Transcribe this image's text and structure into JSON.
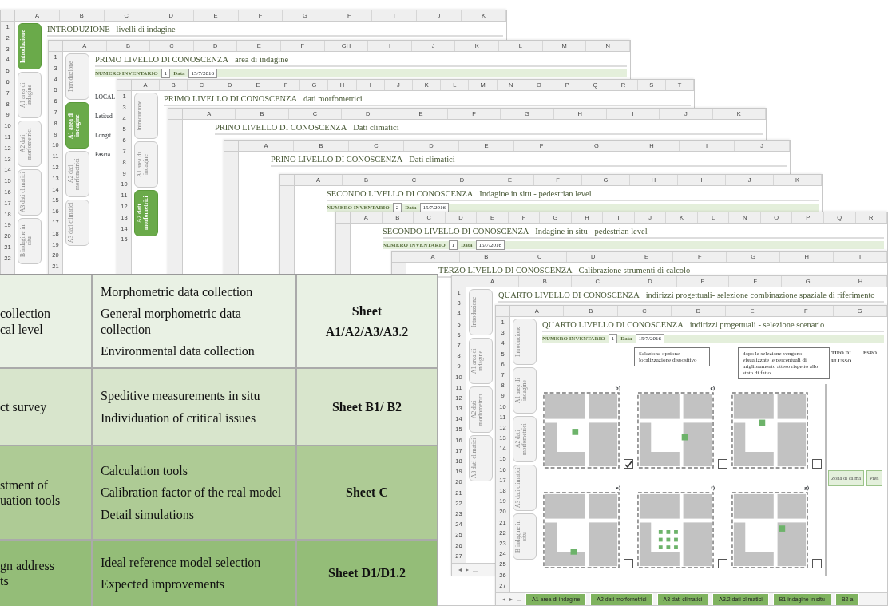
{
  "sheets": [
    {
      "title": "INTRODUZIONE",
      "subtitle": "livelli di indagine",
      "columns": [
        "A",
        "B",
        "C",
        "D",
        "E",
        "F",
        "G",
        "H",
        "I",
        "J",
        "K"
      ],
      "rows": [
        "1",
        "2",
        "3",
        "4",
        "5",
        "6",
        "7",
        "8",
        "9",
        "10",
        "11",
        "12",
        "13",
        "14",
        "15",
        "16",
        "17",
        "18",
        "19",
        "20",
        "21",
        "22"
      ],
      "side_tabs": [
        {
          "label": "Introduzione",
          "selected": true
        },
        {
          "label": "A1 area di indagine",
          "selected": false
        },
        {
          "label": "A2 dati morfometrici",
          "selected": false
        },
        {
          "label": "A3 dati climatici",
          "selected": false
        },
        {
          "label": "B indagine in situ",
          "selected": false
        }
      ]
    },
    {
      "title": "PRIMO LIVELLO DI CONOSCENZA",
      "subtitle": "area di indagine",
      "columns": [
        "A",
        "B",
        "C",
        "D",
        "E",
        "F",
        "GH",
        "I",
        "J",
        "K",
        "L",
        "M",
        "N"
      ],
      "rows": [
        "1",
        "3",
        "4",
        "5",
        "6",
        "7",
        "8",
        "9",
        "10",
        "11",
        "12",
        "13",
        "14",
        "15",
        "16",
        "17",
        "18",
        "19",
        "20",
        "21"
      ],
      "side_tabs": [
        {
          "label": "Introduzione",
          "selected": false
        },
        {
          "label": "A1 area di indagine",
          "selected": true
        },
        {
          "label": "A2 dati morfometrici",
          "selected": false
        },
        {
          "label": "A3 dati climatici",
          "selected": false
        }
      ],
      "inventory": {
        "label": "NUMERO INVENTARIO",
        "number": "1",
        "date_label": "Data",
        "date": "15/7/2016"
      },
      "body_labels": [
        "LOCAL",
        "Latitud",
        "Longit",
        "Fascia"
      ]
    },
    {
      "title": "PRIMO LIVELLO DI CONOSCENZA",
      "subtitle": "dati morfometrici",
      "columns": [
        "A",
        "B",
        "C",
        "D",
        "E",
        "F",
        "G",
        "H",
        "I",
        "J",
        "K",
        "L",
        "M",
        "N",
        "O",
        "P",
        "Q",
        "R",
        "S",
        "T"
      ],
      "rows": [
        "1",
        "3",
        "4",
        "5",
        "6",
        "7",
        "8",
        "9",
        "10",
        "11",
        "12",
        "13",
        "14",
        "15"
      ],
      "side_tabs": [
        {
          "label": "Introduzione",
          "selected": false
        },
        {
          "label": "A1 area di indagine",
          "selected": false
        },
        {
          "label": "A2 dati morfometrici",
          "selected": true
        }
      ]
    },
    {
      "title": "PRINO LIVELLO DI CONOSCENZA",
      "subtitle": "Dati climatici",
      "columns": [
        "A",
        "B",
        "C",
        "D",
        "E",
        "F",
        "G",
        "H",
        "I",
        "J",
        "K"
      ]
    },
    {
      "title": "PRINO LIVELLO DI CONOSCENZA",
      "subtitle": "Dati climatici",
      "columns": [
        "A",
        "B",
        "C",
        "D",
        "E",
        "F",
        "G",
        "H",
        "I",
        "J"
      ]
    },
    {
      "title": "SECONDO LIVELLO DI CONOSCENZA",
      "subtitle": "Indagine in situ - pedestrian level",
      "columns": [
        "A",
        "B",
        "C",
        "D",
        "E",
        "F",
        "G",
        "H",
        "I",
        "J",
        "K"
      ],
      "inventory": {
        "label": "NUMERO INVENTARIO",
        "number": "2",
        "date_label": "Data",
        "date": "15/7/2016"
      }
    },
    {
      "title": "SECONDO LIVELLO DI CONOSCENZA",
      "subtitle": "Indagine in situ - pedestrian level",
      "columns": [
        "A",
        "B",
        "C",
        "D",
        "E",
        "F",
        "G",
        "H",
        "I",
        "J",
        "K",
        "L",
        "N",
        "O",
        "P",
        "Q",
        "R"
      ],
      "inventory": {
        "label": "NUMERO INVENTARIO",
        "number": "1",
        "date_label": "Data",
        "date": "15/7/2016"
      }
    },
    {
      "title": "TERZO LIVELLO DI CONOSCENZA",
      "subtitle": "Calibrazione strumenti di calcolo",
      "columns": [
        "A",
        "B",
        "C",
        "D",
        "E",
        "F",
        "G",
        "H",
        "I"
      ]
    },
    {
      "title": "QUARTO LIVELLO DI CONOSCENZA",
      "subtitle": "indirizzi progettuali- selezione combinazione spaziale di riferimento",
      "columns": [
        "A",
        "B",
        "C",
        "D",
        "E",
        "F",
        "G",
        "H"
      ],
      "rows": [
        "1",
        "3",
        "4",
        "5",
        "6",
        "7",
        "8",
        "9",
        "10",
        "11",
        "12",
        "13",
        "14",
        "15",
        "16",
        "17",
        "18",
        "19",
        "20",
        "21",
        "22",
        "23",
        "24",
        "25",
        "26",
        "27"
      ],
      "side_tabs": [
        {
          "label": "Introduzione",
          "selected": false
        },
        {
          "label": "A1 area di indagine",
          "selected": false
        },
        {
          "label": "A2 dati morfometrici",
          "selected": false
        },
        {
          "label": "A3 dati climatici",
          "selected": false
        }
      ],
      "nav": [
        "◂",
        "▸",
        "..."
      ]
    },
    {
      "title": "QUARTO LIVELLO DI CONOSCENZA",
      "subtitle": "indirizzi progettuali - selezione scenario",
      "columns": [
        "A",
        "B",
        "C",
        "D",
        "E",
        "F",
        "G"
      ],
      "rows": [
        "1",
        "3",
        "4",
        "5",
        "6",
        "7",
        "8",
        "9",
        "10",
        "11",
        "12",
        "13",
        "14",
        "15",
        "16",
        "17",
        "18",
        "19",
        "20",
        "21",
        "22",
        "23",
        "24",
        "25",
        "26",
        "27"
      ],
      "side_tabs": [
        {
          "label": "Introduzione",
          "selected": false
        },
        {
          "label": "A1 area di indagine",
          "selected": false
        },
        {
          "label": "A2 dati morfometrici",
          "selected": false
        },
        {
          "label": "A3 dati climatici",
          "selected": false
        },
        {
          "label": "B indagine in situ",
          "selected": false
        }
      ],
      "inventory": {
        "label": "NUMERO INVENTARIO",
        "number": "1",
        "date_label": "Data",
        "date": "15/7/2016"
      },
      "callouts": [
        "Selezione opzione localizzazione dispositivo",
        "dopo la selezione vengono visualizzate le percentuali di miglioramento atteso rispetto allo stato di fatto"
      ],
      "scenarios": [
        {
          "label": "b)",
          "checked": true
        },
        {
          "label": "c)",
          "checked": false
        },
        {
          "checked": false
        },
        {
          "label": "e)",
          "checked": false
        },
        {
          "label": "f)",
          "checked": false
        },
        {
          "label": "g)",
          "checked": false
        }
      ],
      "flow": {
        "heading": "TIPO DI FLUSSO",
        "heading_2": "ESPO",
        "box_1": "Zona di calma",
        "box_2": "Pien"
      },
      "nav": [
        "◂",
        "▸",
        "..."
      ],
      "sheet_tabs": [
        "A1 area di indagine",
        "A2 dati morfometrici",
        "A3 dati climatici",
        "A3.2 dati climatici",
        "B1 indagine in situ",
        "B2 a"
      ]
    }
  ],
  "table": {
    "rows": [
      {
        "column_1": [
          "collection",
          "cal level"
        ],
        "items": [
          "Morphometric data collection",
          "General morphometric data collection",
          "Environmental data collection"
        ],
        "sheet": [
          "Sheet",
          "A1/A2/A3/A3.2"
        ]
      },
      {
        "column_1": [
          "ct survey"
        ],
        "items": [
          "Speditive measurements in situ",
          "Individuation of critical issues"
        ],
        "sheet": [
          "Sheet B1/ B2"
        ]
      },
      {
        "column_1": [
          "stment of",
          "uation tools"
        ],
        "items": [
          "Calculation tools",
          "Calibration factor of the real model",
          "Detail simulations"
        ],
        "sheet": [
          "Sheet C"
        ]
      },
      {
        "column_1": [
          "gn address",
          "ts"
        ],
        "items": [
          "Ideal reference model selection",
          "Expected improvements"
        ],
        "sheet": [
          "Sheet D1/D1.2"
        ]
      }
    ]
  }
}
